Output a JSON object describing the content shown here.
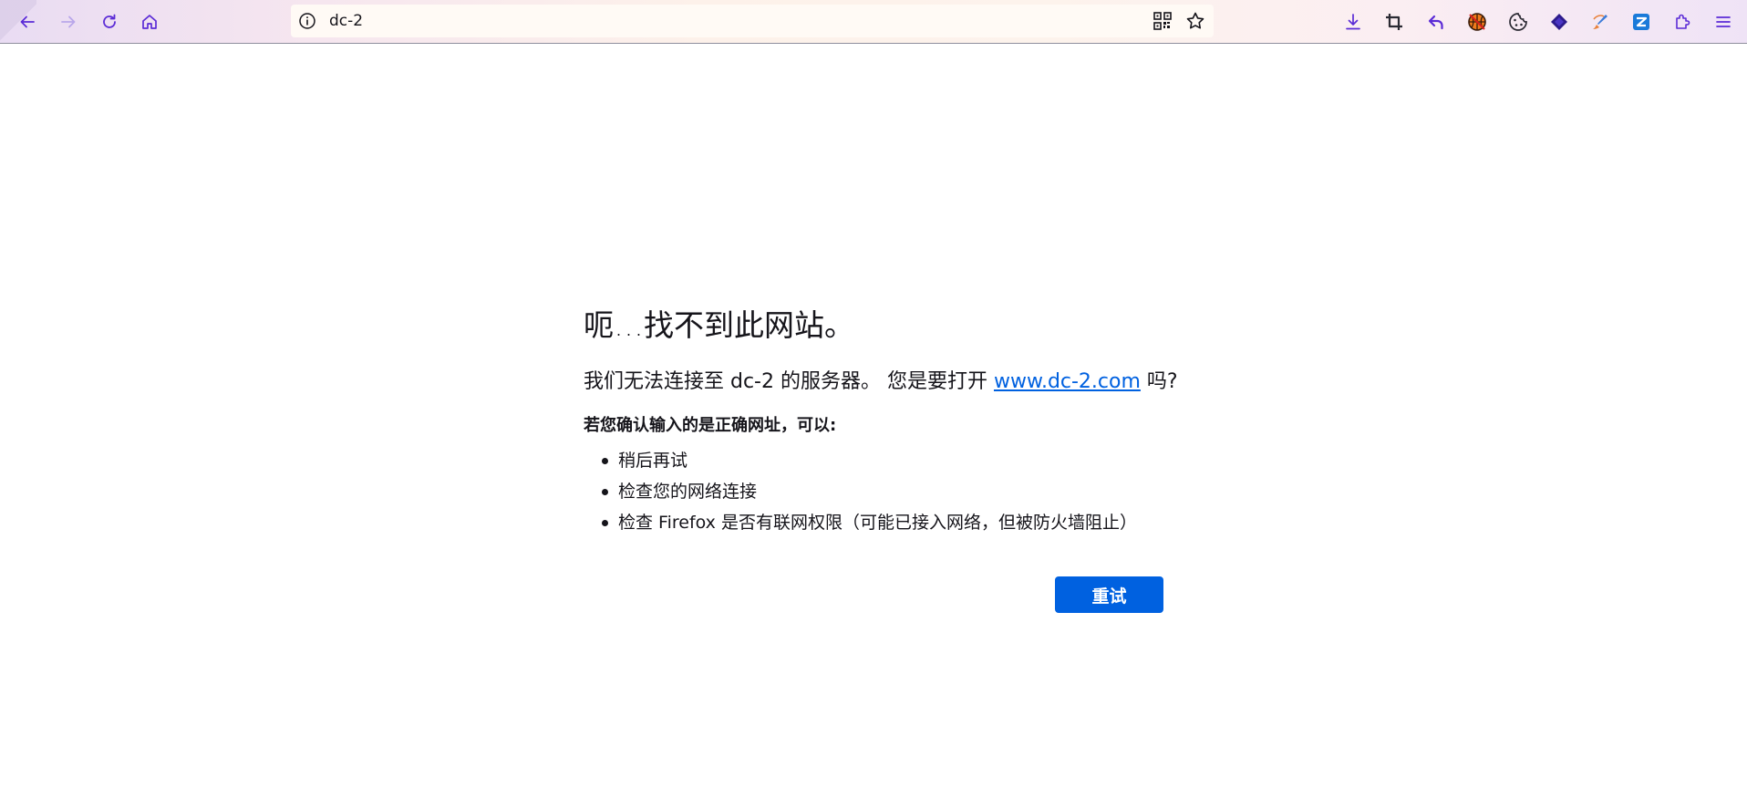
{
  "toolbar": {
    "back_icon": "back-arrow-icon",
    "forward_icon": "forward-arrow-icon",
    "reload_icon": "reload-icon",
    "home_icon": "home-icon",
    "url": "dc-2",
    "extensions": [
      "downloads-icon",
      "crop-screenshot-icon",
      "undo-arrow-icon",
      "basketball-extension-icon",
      "cookie-icon",
      "stack-layers-icon",
      "paint-brush-icon",
      "zotero-icon",
      "extensions-puzzle-icon",
      "menu-hamburger-icon"
    ],
    "accent": "#5b2bd6"
  },
  "error": {
    "title": "呃…找不到此网站。",
    "desc_prefix": "我们无法连接至 dc-2 的服务器。 您是要打开 ",
    "desc_link": "www.dc-2.com",
    "desc_suffix": " 吗?",
    "subhead": "若您确认输入的是正确网址，可以:",
    "tips": [
      "稍后再试",
      "检查您的网络连接",
      "检查 Firefox 是否有联网权限（可能已接入网络，但被防火墙阻止）"
    ],
    "retry_label": "重试",
    "link_color": "#0061e0",
    "button_color": "#0061e0"
  }
}
